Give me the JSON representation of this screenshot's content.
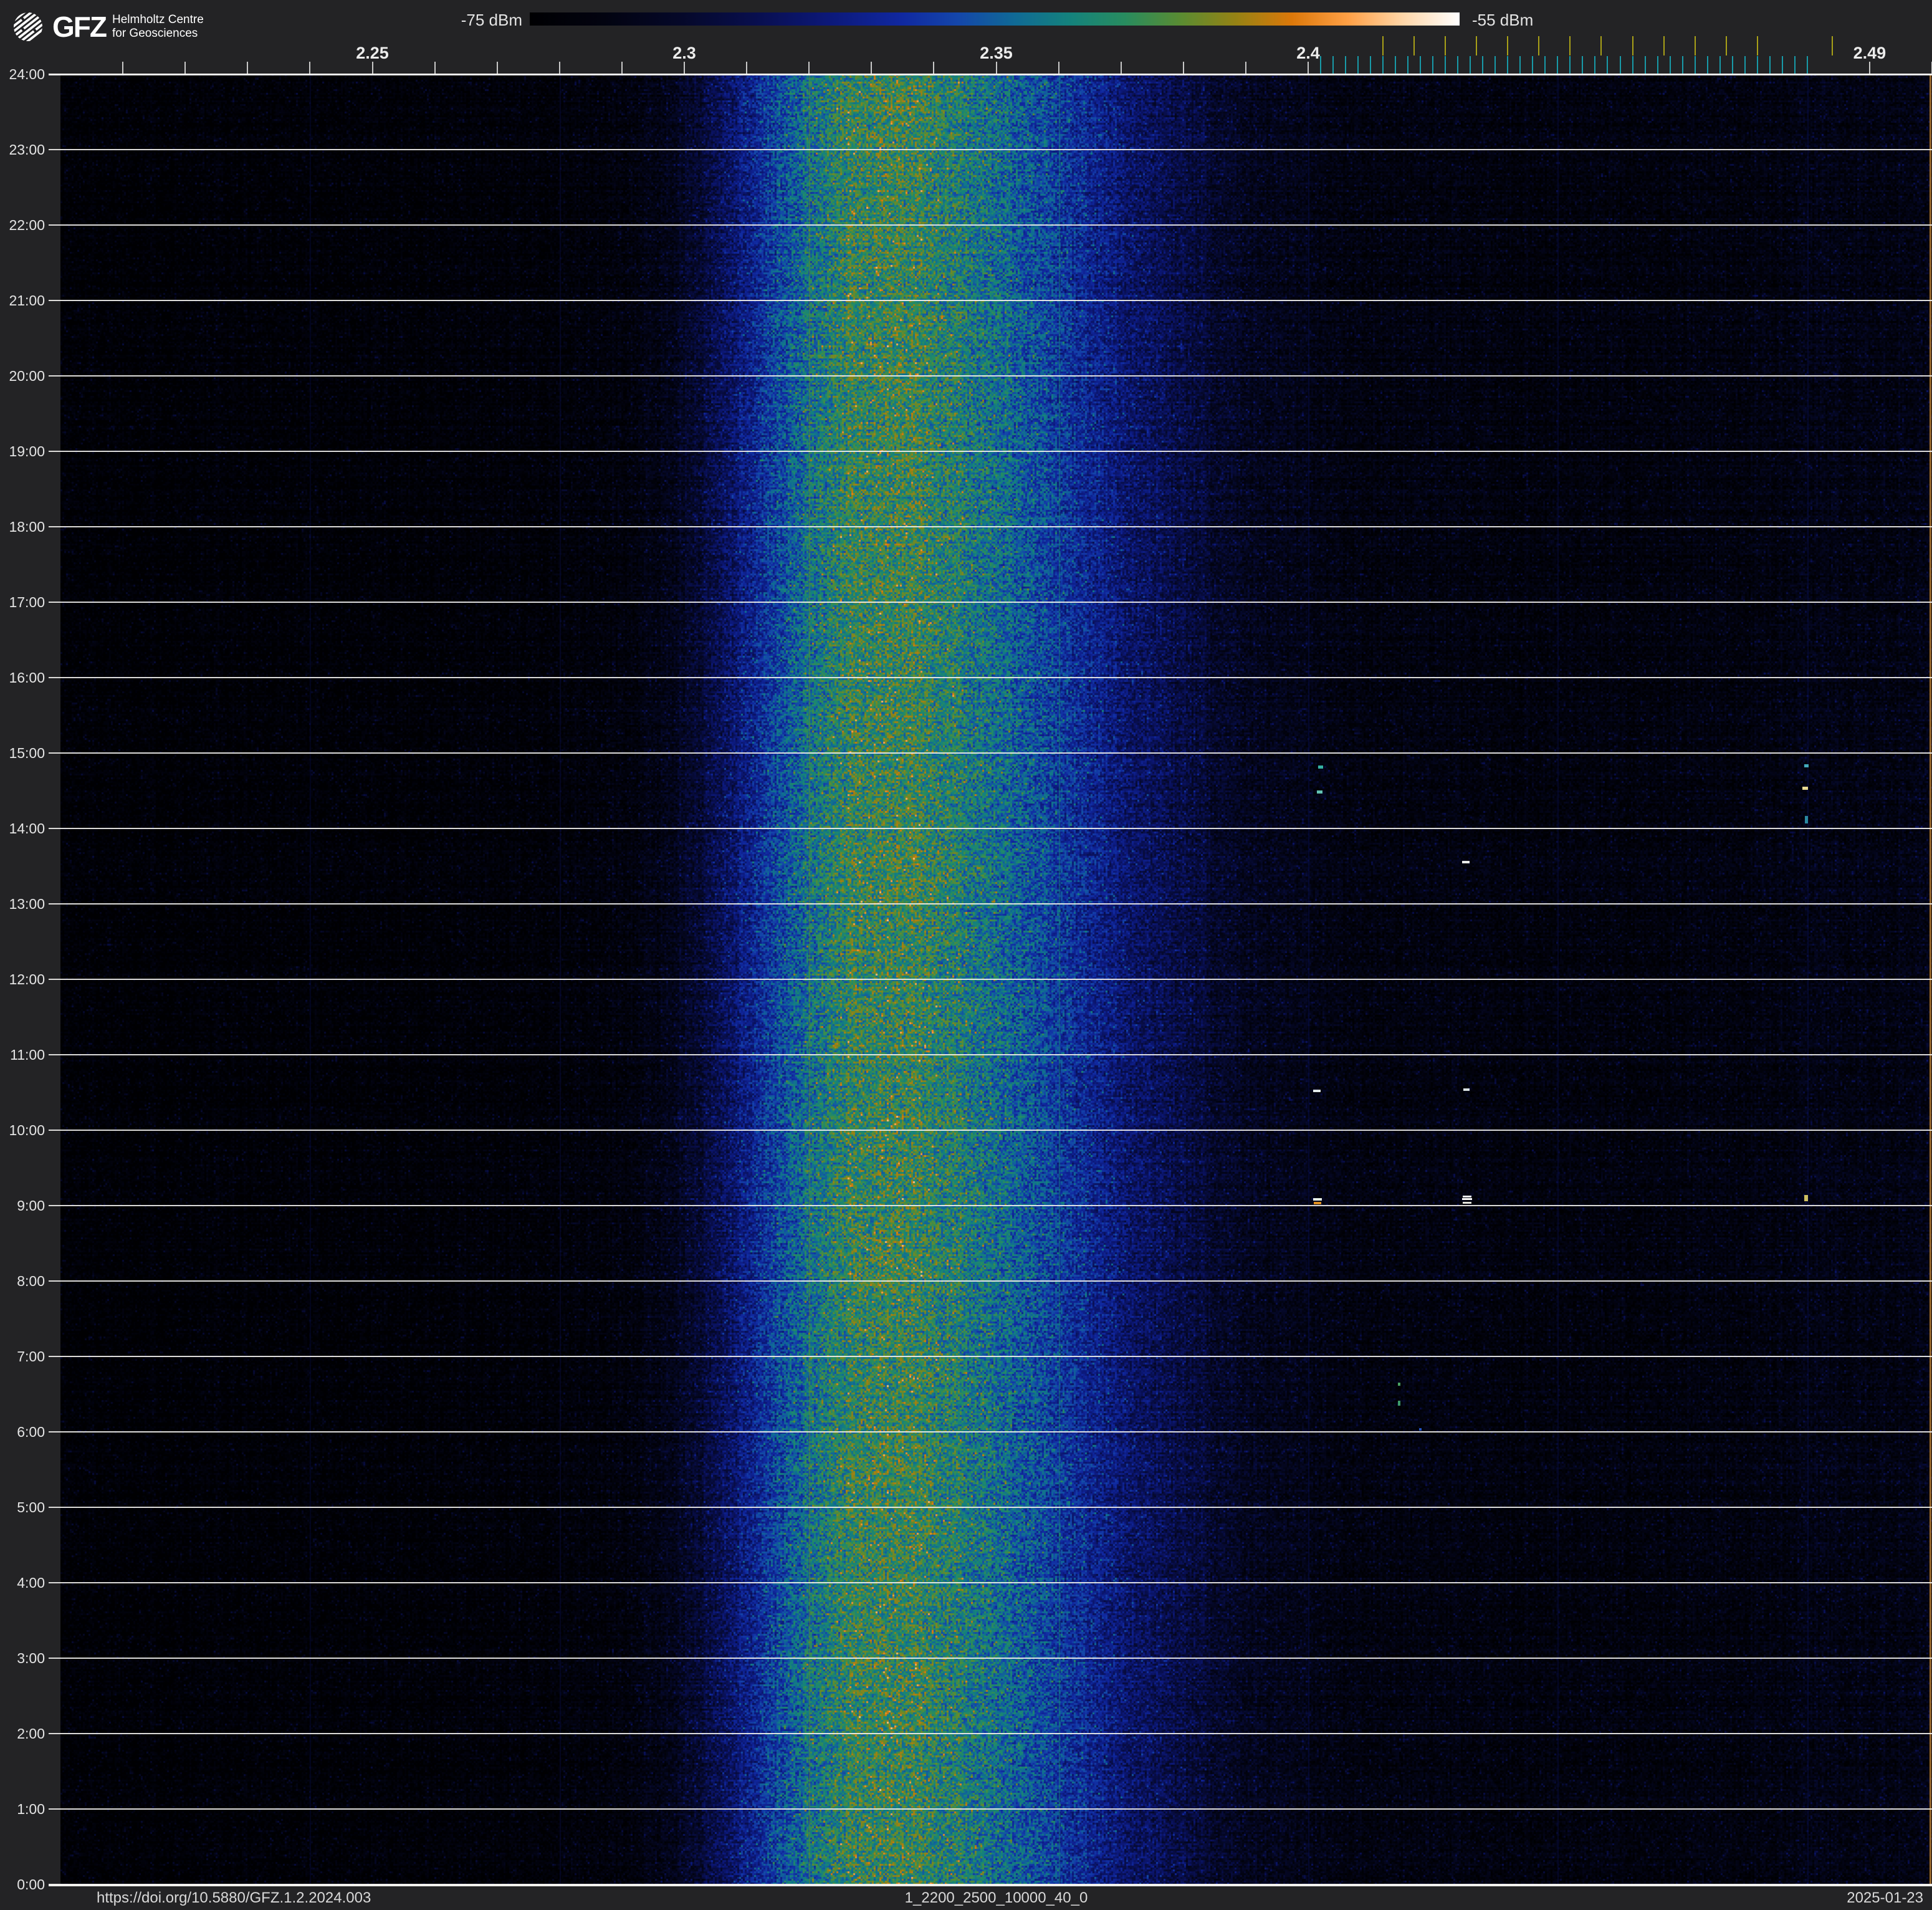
{
  "header": {
    "logo": {
      "brand": "GFZ",
      "line1": "Helmholtz Centre",
      "line2": "for Geosciences"
    },
    "colorbar": {
      "min_label": "-75 dBm",
      "max_label": "-55 dBm"
    }
  },
  "footer": {
    "doi": "https://doi.org/10.5880/GFZ.1.2.2024.003",
    "dataset": "1_2200_2500_10000_40_0",
    "date": "2025-01-23"
  },
  "chart_data": {
    "type": "heatmap",
    "subtype": "spectrogram-waterfall",
    "power_scale": {
      "min_dbm": -75,
      "max_dbm": -55,
      "unit": "dBm"
    },
    "freq_axis": {
      "min_mhz": 2200,
      "max_mhz": 2500,
      "labels": [
        {
          "text": "2.25",
          "mhz": 2250
        },
        {
          "text": "2.3",
          "mhz": 2300
        },
        {
          "text": "2.35",
          "mhz": 2350
        },
        {
          "text": "2.4",
          "mhz": 2400
        },
        {
          "text": "2.49",
          "mhz": 2490
        }
      ],
      "minor_ticks_mhz": [
        2210,
        2220,
        2230,
        2240,
        2250,
        2260,
        2270,
        2280,
        2290,
        2300,
        2310,
        2320,
        2330,
        2340,
        2350,
        2360,
        2370,
        2380,
        2390,
        2400,
        2490,
        2500
      ],
      "wifi_channel_ticks_mhz": [
        2412,
        2417,
        2422,
        2427,
        2432,
        2437,
        2442,
        2447,
        2452,
        2457,
        2462,
        2467,
        2472,
        2484
      ],
      "ble_channel_ticks_mhz": [
        2402,
        2404,
        2406,
        2408,
        2410,
        2412,
        2414,
        2416,
        2418,
        2420,
        2422,
        2424,
        2426,
        2428,
        2430,
        2432,
        2434,
        2436,
        2438,
        2440,
        2442,
        2444,
        2446,
        2448,
        2450,
        2452,
        2454,
        2456,
        2458,
        2460,
        2462,
        2464,
        2466,
        2468,
        2470,
        2472,
        2474,
        2476,
        2478,
        2480
      ]
    },
    "time_axis": {
      "direction": "bottom-to-top",
      "labels": [
        "24:00",
        "23:00",
        "22:00",
        "21:00",
        "20:00",
        "19:00",
        "18:00",
        "17:00",
        "16:00",
        "15:00",
        "14:00",
        "13:00",
        "12:00",
        "11:00",
        "10:00",
        "9:00",
        "8:00",
        "7:00",
        "6:00",
        "5:00",
        "4:00",
        "3:00",
        "2:00",
        "1:00",
        "0:00"
      ],
      "hours_span": 24
    },
    "colormap_stops": [
      [
        0.0,
        "#000002"
      ],
      [
        0.08,
        "#020310"
      ],
      [
        0.16,
        "#050828"
      ],
      [
        0.24,
        "#080e4c"
      ],
      [
        0.32,
        "#0c1878"
      ],
      [
        0.4,
        "#1028a0"
      ],
      [
        0.46,
        "#1446aa"
      ],
      [
        0.52,
        "#106996"
      ],
      [
        0.58,
        "#14827d"
      ],
      [
        0.64,
        "#288c5f"
      ],
      [
        0.7,
        "#5a8c32"
      ],
      [
        0.76,
        "#968214"
      ],
      [
        0.82,
        "#dc780a"
      ],
      [
        0.88,
        "#ffa046"
      ],
      [
        0.94,
        "#ffd7aa"
      ],
      [
        1.0,
        "#ffffff"
      ]
    ],
    "power_profile": [
      [
        2200,
        0.02
      ],
      [
        2240,
        0.025
      ],
      [
        2270,
        0.03
      ],
      [
        2288,
        0.05
      ],
      [
        2296,
        0.09
      ],
      [
        2302,
        0.17
      ],
      [
        2308,
        0.3
      ],
      [
        2314,
        0.43
      ],
      [
        2320,
        0.54
      ],
      [
        2326,
        0.62
      ],
      [
        2332,
        0.65
      ],
      [
        2338,
        0.63
      ],
      [
        2344,
        0.59
      ],
      [
        2350,
        0.54
      ],
      [
        2356,
        0.47
      ],
      [
        2362,
        0.4
      ],
      [
        2370,
        0.31
      ],
      [
        2378,
        0.23
      ],
      [
        2386,
        0.16
      ],
      [
        2394,
        0.11
      ],
      [
        2402,
        0.08
      ],
      [
        2420,
        0.065
      ],
      [
        2440,
        0.06
      ],
      [
        2458,
        0.06
      ],
      [
        2472,
        0.07
      ],
      [
        2482,
        0.085
      ],
      [
        2500,
        0.09
      ]
    ],
    "segment_boundaries_mhz": [
      2240,
      2280,
      2320,
      2360,
      2400,
      2440,
      2480
    ],
    "transients": [
      {
        "mhz": 2401.5,
        "time": "9:05",
        "w": 14,
        "h": 4,
        "color": "#e6efe6"
      },
      {
        "mhz": 2401.5,
        "time": "9:02",
        "w": 12,
        "h": 4,
        "color": "#de8f20"
      },
      {
        "mhz": 2425.5,
        "time": "9:07",
        "w": 14,
        "h": 3,
        "color": "#eef2f2"
      },
      {
        "mhz": 2425.5,
        "time": "9:05",
        "w": 16,
        "h": 3,
        "color": "#ffffff"
      },
      {
        "mhz": 2425.5,
        "time": "9:02",
        "w": 14,
        "h": 3,
        "color": "#e4e4dc"
      },
      {
        "mhz": 2479.8,
        "time": "9:06",
        "w": 6,
        "h": 10,
        "color": "#cfc060"
      },
      {
        "mhz": 2402.0,
        "time": "14:49",
        "w": 8,
        "h": 5,
        "color": "#35b2a2"
      },
      {
        "mhz": 2401.8,
        "time": "14:29",
        "w": 9,
        "h": 5,
        "color": "#63c2b2"
      },
      {
        "mhz": 2479.9,
        "time": "14:50",
        "w": 7,
        "h": 5,
        "color": "#42aaba"
      },
      {
        "mhz": 2479.7,
        "time": "14:32",
        "w": 9,
        "h": 5,
        "color": "#e9da92"
      },
      {
        "mhz": 2479.9,
        "time": "14:07",
        "w": 5,
        "h": 12,
        "color": "#2a8aa2"
      },
      {
        "mhz": 2401.4,
        "time": "10:31",
        "w": 12,
        "h": 4,
        "color": "#e2eaea"
      },
      {
        "mhz": 2425.4,
        "time": "10:32",
        "w": 10,
        "h": 4,
        "color": "#dae2e2"
      },
      {
        "mhz": 2425.3,
        "time": "13:33",
        "w": 12,
        "h": 4,
        "color": "#eaeaea"
      },
      {
        "mhz": 2414.6,
        "time": "6:38",
        "w": 4,
        "h": 5,
        "color": "#4aa262"
      },
      {
        "mhz": 2414.6,
        "time": "6:23",
        "w": 4,
        "h": 8,
        "color": "#3c9a6a"
      },
      {
        "mhz": 2418.0,
        "time": "6:02",
        "w": 4,
        "h": 4,
        "color": "#2252c2"
      }
    ],
    "colors": {
      "background": "#232325",
      "plot_background": "#000003",
      "grid_line": "#efeeea",
      "minor_tick": "#c9c9c9",
      "wifi_tick": "#a8a018",
      "ble_tick": "#189aa8",
      "right_edge_line": "#b97f33",
      "axis_text": "#e4e4e4"
    }
  }
}
